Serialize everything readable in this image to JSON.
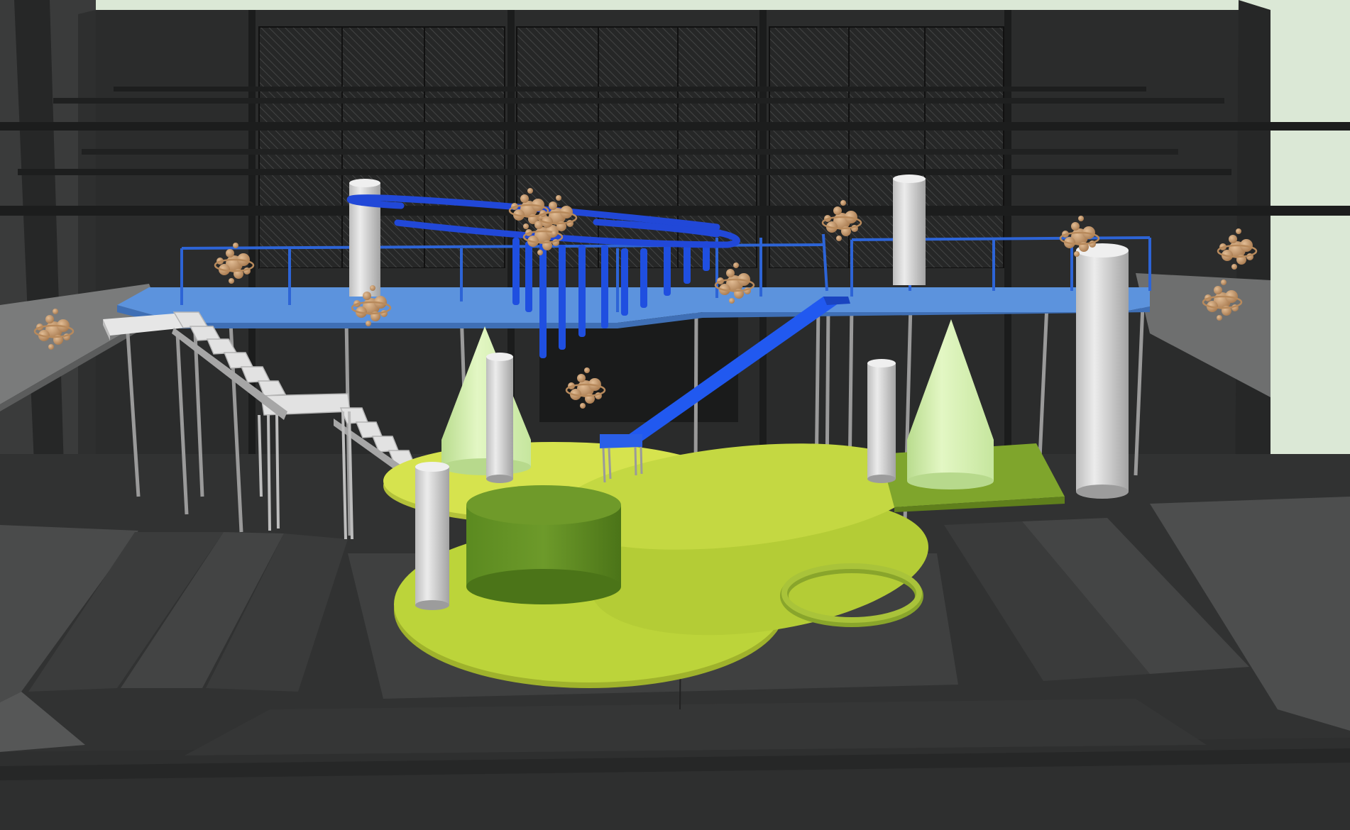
{
  "viewport": {
    "kind": "3d-stage-set-model-render",
    "background_color": "#dbe8d6"
  },
  "colors": {
    "sky_backdrop": "#dbe8d6",
    "back_wall": "#2b2c2c",
    "side_wall": "#3a3b3b",
    "dark_floor": "#313232",
    "mid_floor": "#3d3e3e",
    "light_step": "#4c4d4d",
    "batten": "#242525",
    "catwalk_blue": "#5c93dd",
    "catwalk_blue_dark": "#3f6fb5",
    "rail_blue": "#2d64d6",
    "tube_blue": "#1f4fe0",
    "chute_blue": "#2159f0",
    "column_white": "#d7d7d7",
    "column_shade": "#9c9c9c",
    "stair_white": "#e2e2e2",
    "cone_green": "#d9f3b0",
    "cone_shade": "#b7d98c",
    "disc_yellow": "#d4e24c",
    "disc_lime": "#b6cf38",
    "cylinder_green": "#5e8c22",
    "cylinder_top": "#6f9a2a",
    "platform_green": "#7fa52c",
    "orb_tan": "#c89a6e",
    "support_pole": "#9a9a9a",
    "rail_gray": "#8f8f8f"
  },
  "objects": {
    "catwalk": "blue-catwalk",
    "chute": "blue-chute-slide",
    "stairs": "white-staircase",
    "cones": [
      "green-cone-left",
      "green-cone-right"
    ],
    "columns": [
      "white-column-tall-right",
      "white-column-front-left",
      "white-column-center-left",
      "white-column-center-right",
      "white-column-upper-left",
      "white-column-upper-right"
    ],
    "floor_pieces": [
      "yellow-oval-disc",
      "lime-large-disc",
      "green-drum-cylinder",
      "green-ring",
      "green-rect-platform"
    ],
    "hanging_features": [
      "blue-tube-cluster",
      "blue-spiral-rail"
    ],
    "orb_clusters": 12
  }
}
